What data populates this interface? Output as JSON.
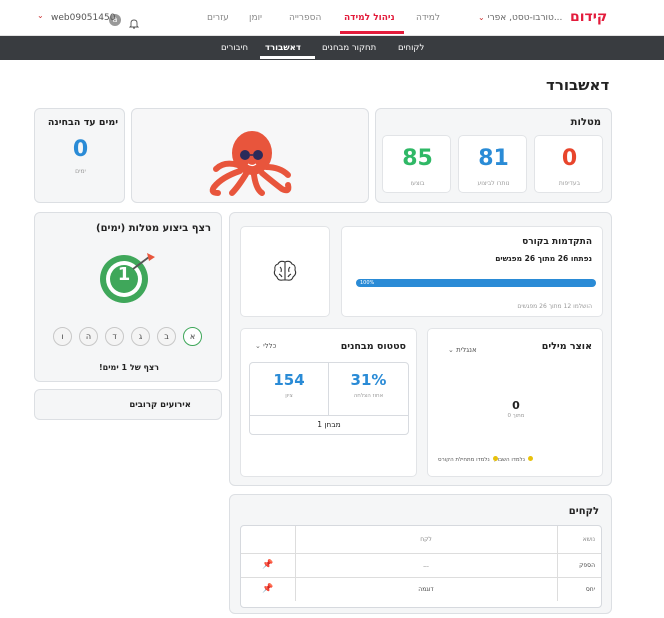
{
  "topbar": {
    "logo": "קידום",
    "school_select": "טורבו-טסט, אפרי...",
    "nav": [
      "למידה",
      "ניהול למידה",
      "הספרייה",
      "יומן",
      "עזרים"
    ],
    "active_nav": "ניהול למידה",
    "username": "web09051450",
    "avatar_letter": "a"
  },
  "subnav": [
    "לקוחים",
    "תחקור מבחנים",
    "דאשבורד",
    "חיבורים"
  ],
  "page_title": "דאשבורד",
  "tasks": {
    "title": "מטלות",
    "items": [
      {
        "value": "0",
        "label": "בעדיפות",
        "color": "#e8452c"
      },
      {
        "value": "81",
        "label": "נותרו לביצוע",
        "color": "#2a8bd6"
      },
      {
        "value": "85",
        "label": "בוצעו",
        "color": "#2fb866"
      }
    ]
  },
  "days_to_exam": {
    "title": "ימים עד הבחינה",
    "value": "0",
    "unit": "ימים"
  },
  "streak": {
    "title": "רצף ביצוע מטלות (ימים)",
    "count": "1",
    "days": [
      "א",
      "ב",
      "ג",
      "ד",
      "ה",
      "ו"
    ],
    "active_day": "א",
    "caption": "רצף של 1 ימים!"
  },
  "events": {
    "title": "אירועים קרובים"
  },
  "progress": {
    "title": "התקדמות בקורס",
    "subtitle": "נפתחו 26 מתוך 26 מפגשים",
    "percent_label": "100%",
    "percent": 1.0,
    "footer": "הושלמו 12 מתוך 26 מפגשים"
  },
  "vocab": {
    "title": "אוצר מילים",
    "language": "אנגלית",
    "count": "0",
    "count_label": "מתוך 0",
    "legend": [
      "נלמדו השבוע",
      "נלמדו מתחילת הקורס"
    ]
  },
  "exams": {
    "title": "סטטוס מבחנים",
    "filter": "כללי",
    "success_value": "31%",
    "success_label": "אחוז הצלחה",
    "grade_value": "154",
    "grade_label": "ציון",
    "footer": "מבחן 1"
  },
  "lessons": {
    "title": "לקחים",
    "columns": [
      "נושא",
      "לקח"
    ],
    "rows": [
      {
        "topic": "הספק",
        "lesson": "..."
      },
      {
        "topic": "יחס",
        "lesson": "דוגמה"
      }
    ]
  }
}
